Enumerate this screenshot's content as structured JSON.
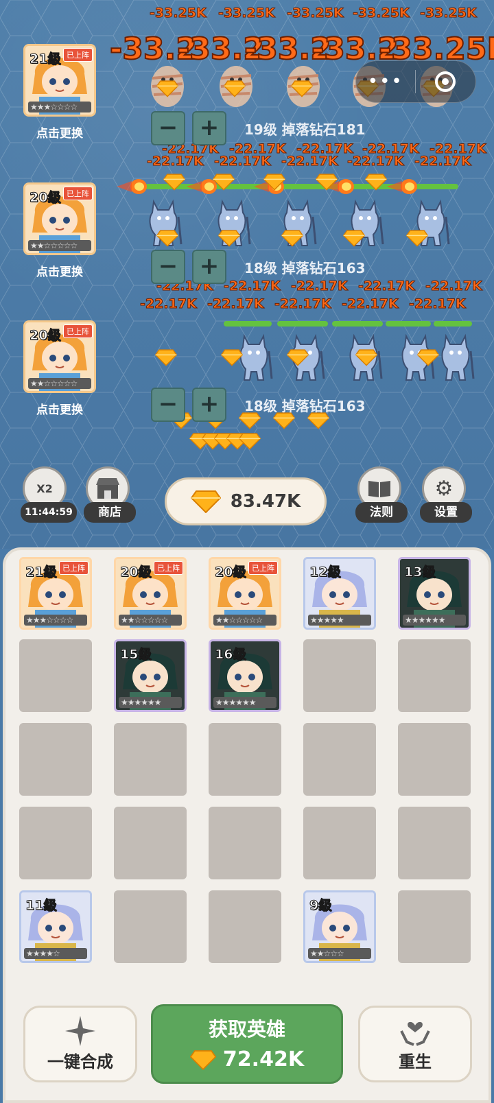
{
  "damage": {
    "big_top": "-33.25K",
    "big_wave": "-33.2",
    "big_wave_end": "-33.25K",
    "small": "-22.17K"
  },
  "lanes": [
    {
      "level": "21级",
      "tag": "已上阵",
      "stars": "★★★☆☆☆☆",
      "swap": "点击更换",
      "info": "19级 掉落钻石181",
      "minus": "−",
      "plus": "+"
    },
    {
      "level": "20级",
      "tag": "已上阵",
      "stars": "★★☆☆☆☆☆",
      "swap": "点击更换",
      "info": "18级 掉落钻石163",
      "minus": "−",
      "plus": "+"
    },
    {
      "level": "20级",
      "tag": "已上阵",
      "stars": "★★☆☆☆☆☆",
      "swap": "点击更换",
      "info": "18级 掉落钻石163",
      "minus": "−",
      "plus": "+"
    }
  ],
  "hud": {
    "double": {
      "icon": "X2",
      "label": "11:44:59"
    },
    "shop": {
      "label": "商店"
    },
    "balance": "83.47K",
    "rules": {
      "label": "法则"
    },
    "settings": {
      "label": "设置"
    }
  },
  "inventory": [
    {
      "level": "21级",
      "tag": "已上阵",
      "stars": "★★★☆☆☆☆",
      "frame": "orange"
    },
    {
      "level": "20级",
      "tag": "已上阵",
      "stars": "★★☆☆☆☆☆",
      "frame": "orange"
    },
    {
      "level": "20级",
      "tag": "已上阵",
      "stars": "★★☆☆☆☆☆",
      "frame": "orange"
    },
    {
      "level": "12级",
      "tag": "",
      "stars": "★★★★★",
      "frame": "blue"
    },
    {
      "level": "13级",
      "tag": "",
      "stars": "★★★★★★",
      "frame": "purple"
    },
    {
      "level": "",
      "tag": "",
      "stars": "",
      "frame": "empty"
    },
    {
      "level": "15级",
      "tag": "",
      "stars": "★★★★★★",
      "frame": "purple"
    },
    {
      "level": "16级",
      "tag": "",
      "stars": "★★★★★★",
      "frame": "purple"
    },
    {
      "level": "",
      "tag": "",
      "stars": "",
      "frame": "empty"
    },
    {
      "level": "",
      "tag": "",
      "stars": "",
      "frame": "empty"
    },
    {
      "level": "",
      "tag": "",
      "stars": "",
      "frame": "empty"
    },
    {
      "level": "",
      "tag": "",
      "stars": "",
      "frame": "empty"
    },
    {
      "level": "",
      "tag": "",
      "stars": "",
      "frame": "empty"
    },
    {
      "level": "",
      "tag": "",
      "stars": "",
      "frame": "empty"
    },
    {
      "level": "",
      "tag": "",
      "stars": "",
      "frame": "empty"
    },
    {
      "level": "",
      "tag": "",
      "stars": "",
      "frame": "empty"
    },
    {
      "level": "",
      "tag": "",
      "stars": "",
      "frame": "empty"
    },
    {
      "level": "",
      "tag": "",
      "stars": "",
      "frame": "empty"
    },
    {
      "level": "",
      "tag": "",
      "stars": "",
      "frame": "empty"
    },
    {
      "level": "",
      "tag": "",
      "stars": "",
      "frame": "empty"
    },
    {
      "level": "11级",
      "tag": "",
      "stars": "★★★★☆",
      "frame": "blue"
    },
    {
      "level": "",
      "tag": "",
      "stars": "",
      "frame": "empty"
    },
    {
      "level": "",
      "tag": "",
      "stars": "",
      "frame": "empty"
    },
    {
      "level": "9级",
      "tag": "",
      "stars": "★★☆☆☆",
      "frame": "blue"
    },
    {
      "level": "",
      "tag": "",
      "stars": "",
      "frame": "empty"
    }
  ],
  "actions": {
    "merge": "一键合成",
    "recruit_title": "获取英雄",
    "recruit_cost": "72.42K",
    "rebirth": "重生"
  },
  "colors": {
    "gem": "#ffb21a",
    "damage": "#ff6a18",
    "hp": "#64c23f",
    "recruit": "#5ca65c"
  }
}
